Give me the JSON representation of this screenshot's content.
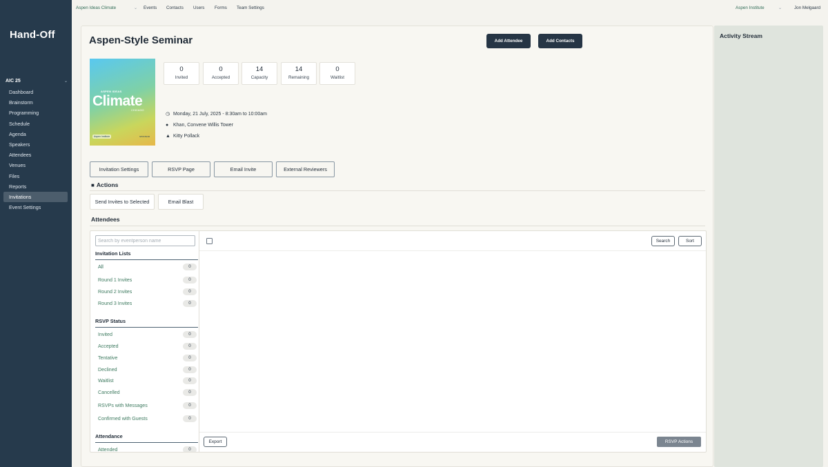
{
  "app": {
    "logo": "Hand-Off"
  },
  "topbar": {
    "org_select": "Aspen Ideas Climate",
    "nav": [
      "Events",
      "Contacts",
      "Users",
      "Forms",
      "Team Settings"
    ],
    "account_select": "Aspen Institute",
    "user": "Jon Melgaard"
  },
  "sidebar": {
    "event": "AIC 25",
    "items": [
      {
        "label": "Dashboard"
      },
      {
        "label": "Brainstorm"
      },
      {
        "label": "Programming"
      },
      {
        "label": "Schedule"
      },
      {
        "label": "Agenda"
      },
      {
        "label": "Speakers"
      },
      {
        "label": "Attendees"
      },
      {
        "label": "Venues"
      },
      {
        "label": "Files"
      },
      {
        "label": "Reports"
      },
      {
        "label": "Invitations",
        "active": true
      },
      {
        "label": "Event Settings"
      }
    ]
  },
  "event": {
    "title": "Aspen-Style Seminar",
    "add_attendee": "Add Attendee",
    "add_contacts": "Add Contacts",
    "poster": {
      "kicker": "ASPEN IDEAS",
      "headline": "Climate",
      "sub": "CHICAGO",
      "badge": "Aspen Institute",
      "sponsor": "SPONSOR"
    },
    "stats": [
      {
        "value": "0",
        "label": "Invited"
      },
      {
        "value": "0",
        "label": "Accepted"
      },
      {
        "value": "14",
        "label": "Capacity"
      },
      {
        "value": "14",
        "label": "Remaining"
      },
      {
        "value": "0",
        "label": "Waitlist"
      }
    ],
    "datetime": "Monday, 21 July, 2025 - 8:30am to 10:00am",
    "location": "Khan, Convene Willis Tower",
    "person": "Kitty Pollack"
  },
  "tabs": [
    "Invitation Settings",
    "RSVP Page",
    "Email Invite",
    "External Reviewers"
  ],
  "actions": {
    "heading": "Actions",
    "send_invites": "Send Invites to Selected",
    "email_blast": "Email Blast"
  },
  "attendees": {
    "heading": "Attendees",
    "search_placeholder": "Search by eventperson name",
    "invitation_lists": {
      "heading": "Invitation Lists",
      "items": [
        {
          "label": "All",
          "count": "0"
        },
        {
          "label": "Round 1 Invites",
          "count": "0"
        },
        {
          "label": "Round 2 Invites",
          "count": "0"
        },
        {
          "label": "Round 3 Invites",
          "count": "0"
        }
      ]
    },
    "rsvp_status": {
      "heading": "RSVP Status",
      "items": [
        {
          "label": "Invited",
          "count": "0"
        },
        {
          "label": "Accepted",
          "count": "0"
        },
        {
          "label": "Tentative",
          "count": "0"
        },
        {
          "label": "Declined",
          "count": "0"
        },
        {
          "label": "Waitlist",
          "count": "0"
        },
        {
          "label": "Cancelled",
          "count": "0"
        },
        {
          "label": "RSVPs with Messages",
          "count": "0"
        },
        {
          "label": "Confirmed with Guests",
          "count": "0"
        }
      ]
    },
    "attendance": {
      "heading": "Attendance",
      "items": [
        {
          "label": "Attended",
          "count": "0"
        }
      ]
    },
    "search_btn": "Search",
    "sort_btn": "Sort",
    "export_btn": "Export",
    "rsvp_actions_btn": "RSVP Actions"
  },
  "activity": {
    "heading": "Activity Stream"
  }
}
